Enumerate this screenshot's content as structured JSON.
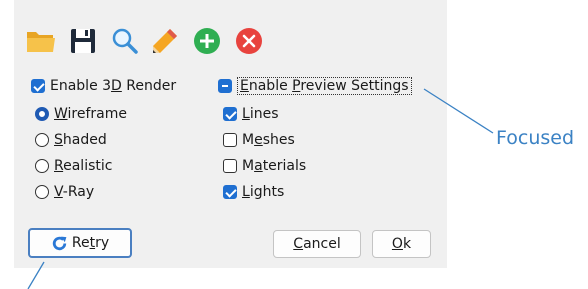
{
  "toolbar": {
    "icons": [
      "folder-open-icon",
      "save-icon",
      "search-icon",
      "pencil-icon",
      "add-icon",
      "delete-icon"
    ]
  },
  "render": {
    "enable_label_pre": "Enable 3",
    "enable_label_u": "D",
    "enable_label_post": " Render",
    "checked": true,
    "options": [
      {
        "u": "W",
        "rest": "ireframe",
        "selected": true
      },
      {
        "u": "S",
        "rest": "haded",
        "selected": false
      },
      {
        "u": "R",
        "rest": "ealistic",
        "selected": false
      },
      {
        "u": "V",
        "rest": "-Ray",
        "selected": false
      }
    ]
  },
  "preview": {
    "enable_label_u": "E",
    "enable_label_mid": "nable ",
    "enable_label_u2": "P",
    "enable_label_post": "review Settings",
    "items": [
      {
        "u": "L",
        "rest": "ines",
        "checked": true
      },
      {
        "pre": "M",
        "u": "e",
        "rest": "shes",
        "checked": false
      },
      {
        "pre": "M",
        "u": "a",
        "rest": "terials",
        "checked": false
      },
      {
        "u": "L",
        "rest": "ights",
        "checked": true
      }
    ]
  },
  "buttons": {
    "retry_pre": "Re",
    "retry_u": "t",
    "retry_post": "ry",
    "cancel_u": "C",
    "cancel_rest": "ancel",
    "ok_u": "O",
    "ok_rest": "k"
  },
  "annotation": {
    "focused": "Focused"
  },
  "colors": {
    "accent": "#1f6fd1",
    "annotation": "#3b82c4",
    "panel": "#f0f0f0"
  }
}
